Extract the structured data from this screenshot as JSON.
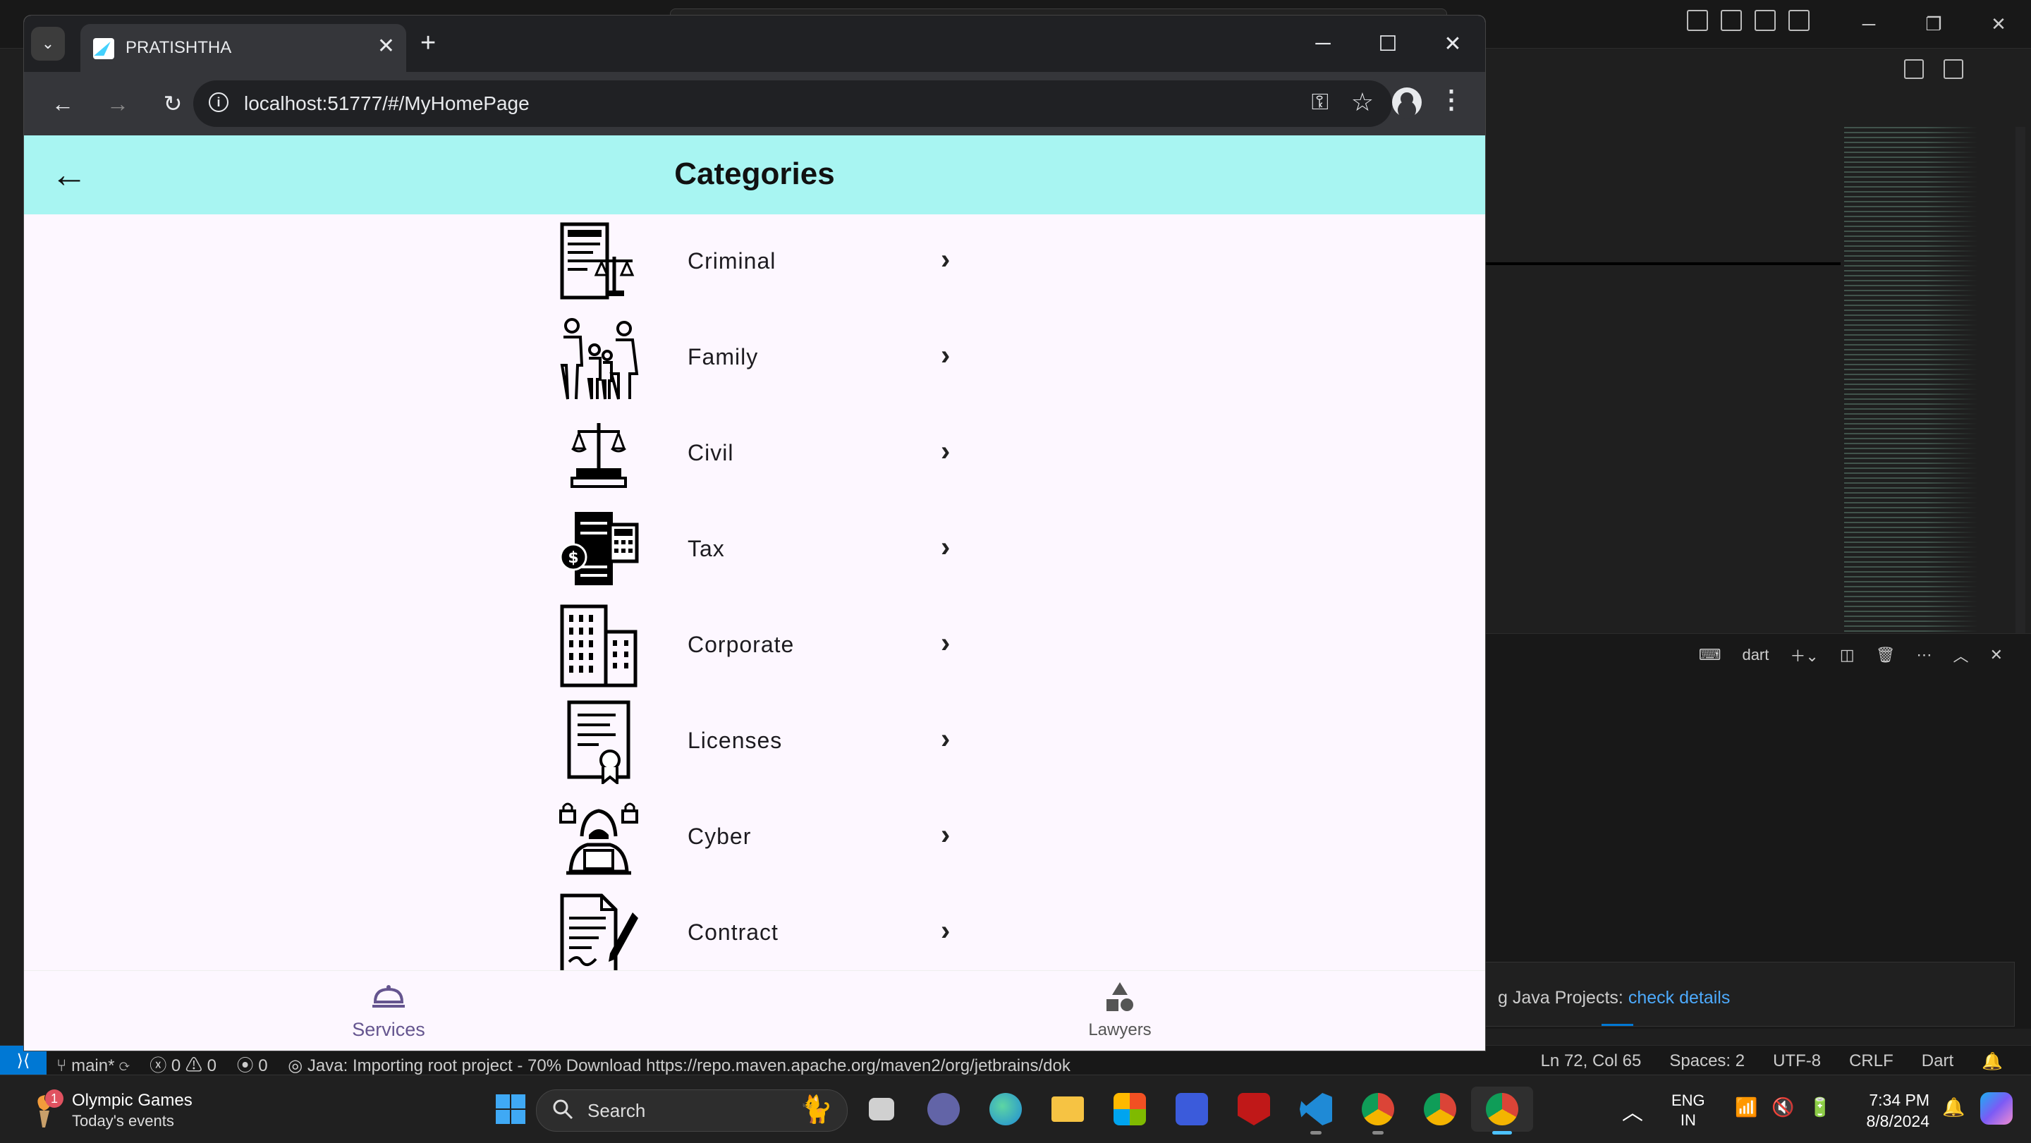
{
  "browser": {
    "tab_title": "PRATISHTHA",
    "url": "localhost:51777/#/MyHomePage"
  },
  "app": {
    "title": "Categories",
    "categories": [
      {
        "label": "Criminal",
        "icon": "criminal-law-icon"
      },
      {
        "label": "Family",
        "icon": "family-icon"
      },
      {
        "label": "Civil",
        "icon": "civil-scales-icon"
      },
      {
        "label": "Tax",
        "icon": "tax-calculator-icon"
      },
      {
        "label": "Corporate",
        "icon": "corporate-building-icon"
      },
      {
        "label": "Licenses",
        "icon": "license-certificate-icon"
      },
      {
        "label": "Cyber",
        "icon": "cyber-hacker-icon"
      },
      {
        "label": "Contract",
        "icon": "contract-pen-icon"
      }
    ],
    "nav": {
      "services": "Services",
      "lawyers": "Lawyers"
    },
    "colors": {
      "appbar": "#a8f5f2",
      "background": "#fdf7ff",
      "nav_active": "#65558f"
    }
  },
  "vscode": {
    "terminal_label": "dart",
    "notification_text": "g Java Projects:",
    "notification_link": "check details",
    "status": {
      "branch": "main*",
      "errors": "0",
      "warnings": "0",
      "ports": "0",
      "message": "Java: Importing root project - 70% Download https://repo.maven.apache.org/maven2/org/jetbrains/dok",
      "position": "Ln 72, Col 65",
      "spaces": "Spaces: 2",
      "encoding": "UTF-8",
      "eol": "CRLF",
      "language": "Dart"
    }
  },
  "taskbar": {
    "widget_badge": "1",
    "widget_title": "Olympic Games",
    "widget_subtitle": "Today's events",
    "search_placeholder": "Search",
    "lang_1": "ENG",
    "lang_2": "IN",
    "time": "7:34 PM",
    "date": "8/8/2024"
  }
}
